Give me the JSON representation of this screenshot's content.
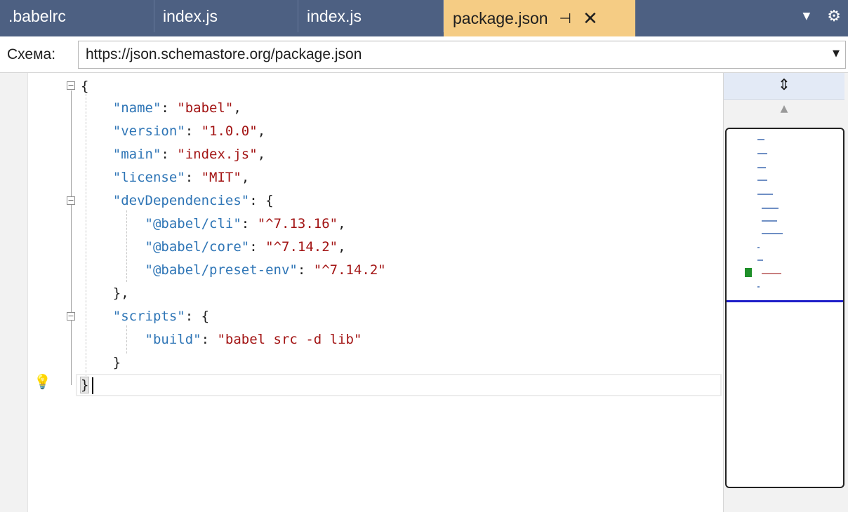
{
  "tabs": [
    {
      "label": ".babelrc"
    },
    {
      "label": "index.js"
    },
    {
      "label": "index.js"
    },
    {
      "label": "package.json",
      "active": true
    }
  ],
  "tab_actions": {
    "pin_icon": "pin-icon",
    "close_icon": "close-icon",
    "dropdown_icon": "dropdown-icon",
    "settings_icon": "gear-icon"
  },
  "schema": {
    "label": "Схема:",
    "value": "https://json.schemastore.org/package.json"
  },
  "code": {
    "open_brace": "{",
    "close_brace": "}",
    "name_key": "\"name\"",
    "name_val": "\"babel\"",
    "version_key": "\"version\"",
    "version_val": "\"1.0.0\"",
    "main_key": "\"main\"",
    "main_val": "\"index.js\"",
    "license_key": "\"license\"",
    "license_val": "\"MIT\"",
    "devdeps_key": "\"devDependencies\"",
    "cli_key": "\"@babel/cli\"",
    "cli_val": "\"^7.13.16\"",
    "core_key": "\"@babel/core\"",
    "core_val": "\"^7.14.2\"",
    "preset_key": "\"@babel/preset-env\"",
    "preset_val": "\"^7.14.2\"",
    "scripts_key": "\"scripts\"",
    "build_key": "\"build\"",
    "build_val": "\"babel src -d lib\""
  },
  "colors": {
    "tabbar": "#4d6082",
    "active_tab": "#f5cc84",
    "json_key": "#2e75b6",
    "json_string": "#a31515"
  }
}
